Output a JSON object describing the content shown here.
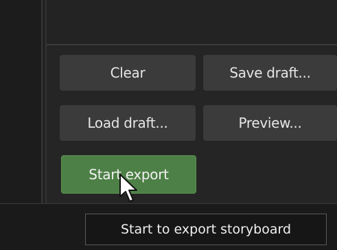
{
  "actions": {
    "clear_label": "Clear",
    "save_draft_label": "Save draft...",
    "load_draft_label": "Load draft...",
    "preview_label": "Preview...",
    "start_export_label": "Start export"
  },
  "tooltip": {
    "text": "Start to export storyboard"
  },
  "colors": {
    "background": "#1e1e1e",
    "panel": "#252525",
    "button": "#3b3b3b",
    "accent_green": "#4d8046",
    "tooltip_bg": "#161616",
    "tooltip_border": "#5a5a5a"
  },
  "icons": {
    "cursor": "mouse-pointer-icon"
  }
}
